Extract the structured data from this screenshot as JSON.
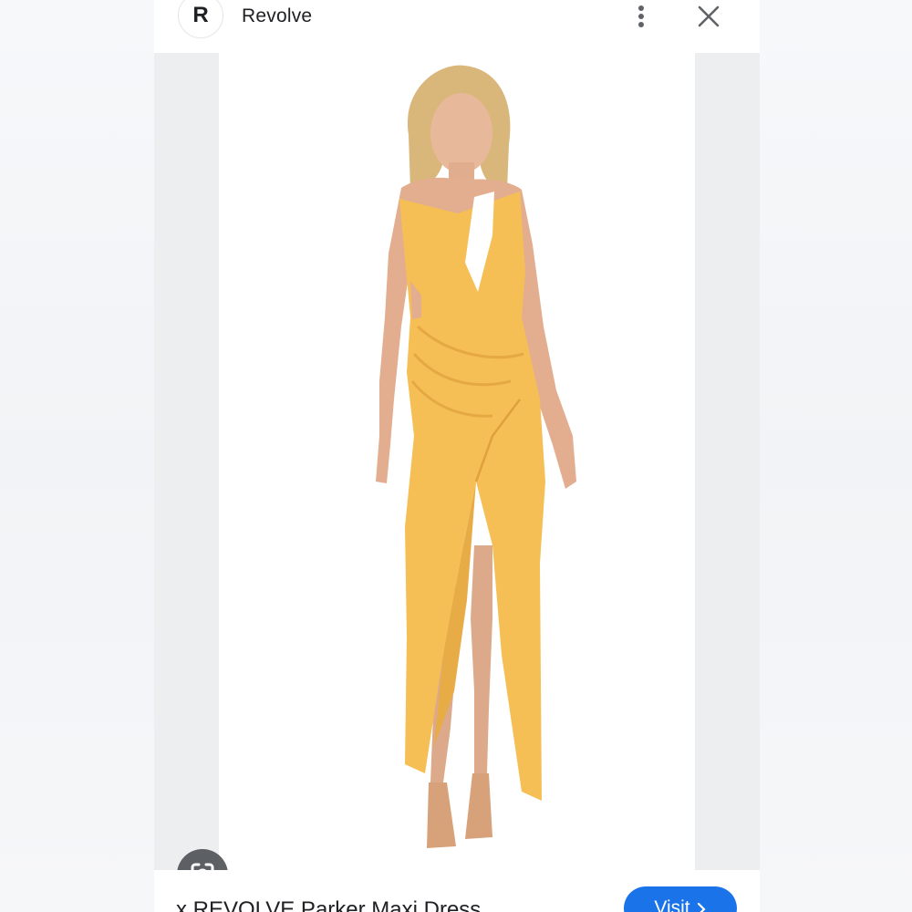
{
  "header": {
    "source_logo_letter": "R",
    "source_name": "Revolve",
    "icons": [
      "more-vert-icon",
      "close-icon"
    ]
  },
  "image": {
    "dress_color": "#f5bf55",
    "lens_icon": "google-lens-icon"
  },
  "footer": {
    "title": "x REVOLVE Parker Maxi Dress",
    "visit_label": "Visit",
    "visit_icon": "chevron-right-icon",
    "accent_color": "#1a73e8"
  }
}
